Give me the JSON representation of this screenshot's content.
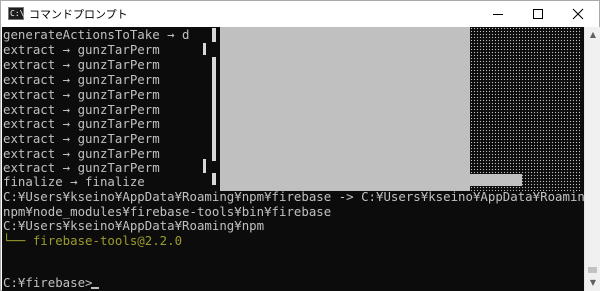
{
  "window": {
    "title": "コマンドプロンプト",
    "icon_label": "C:\\",
    "icon_name": "cmd-app-icon"
  },
  "captions": {
    "minimize_icon": "minimize-icon",
    "maximize_icon": "maximize-icon",
    "close_icon": "close-icon"
  },
  "console": {
    "lines": [
      "generateActionsToTake → d",
      "extract → gunzTarPerm",
      "extract → gunzTarPerm",
      "extract → gunzTarPerm",
      "extract → gunzTarPerm",
      "extract → gunzTarPerm",
      "extract → gunzTarPerm",
      "extract → gunzTarPerm",
      "extract → gunzTarPerm",
      "extract → gunzTarPerm",
      "finalize → finalize",
      "C:¥Users¥kseino¥AppData¥Roaming¥npm¥firebase -> C:¥Users¥kseino¥AppData¥Roaming¥",
      "npm¥node_modules¥firebase-tools¥bin¥firebase",
      "C:¥Users¥kseino¥AppData¥Roaming¥npm",
      "└── firebase-tools@2.2.0",
      "",
      "",
      "C:¥firebase>"
    ],
    "colors": {
      "background": "#0c0c0c",
      "text": "#c0c0c0",
      "highlight": "#9b9b2c"
    }
  },
  "scrollbar": {
    "up_arrow": "▲",
    "down_arrow": "▼"
  }
}
